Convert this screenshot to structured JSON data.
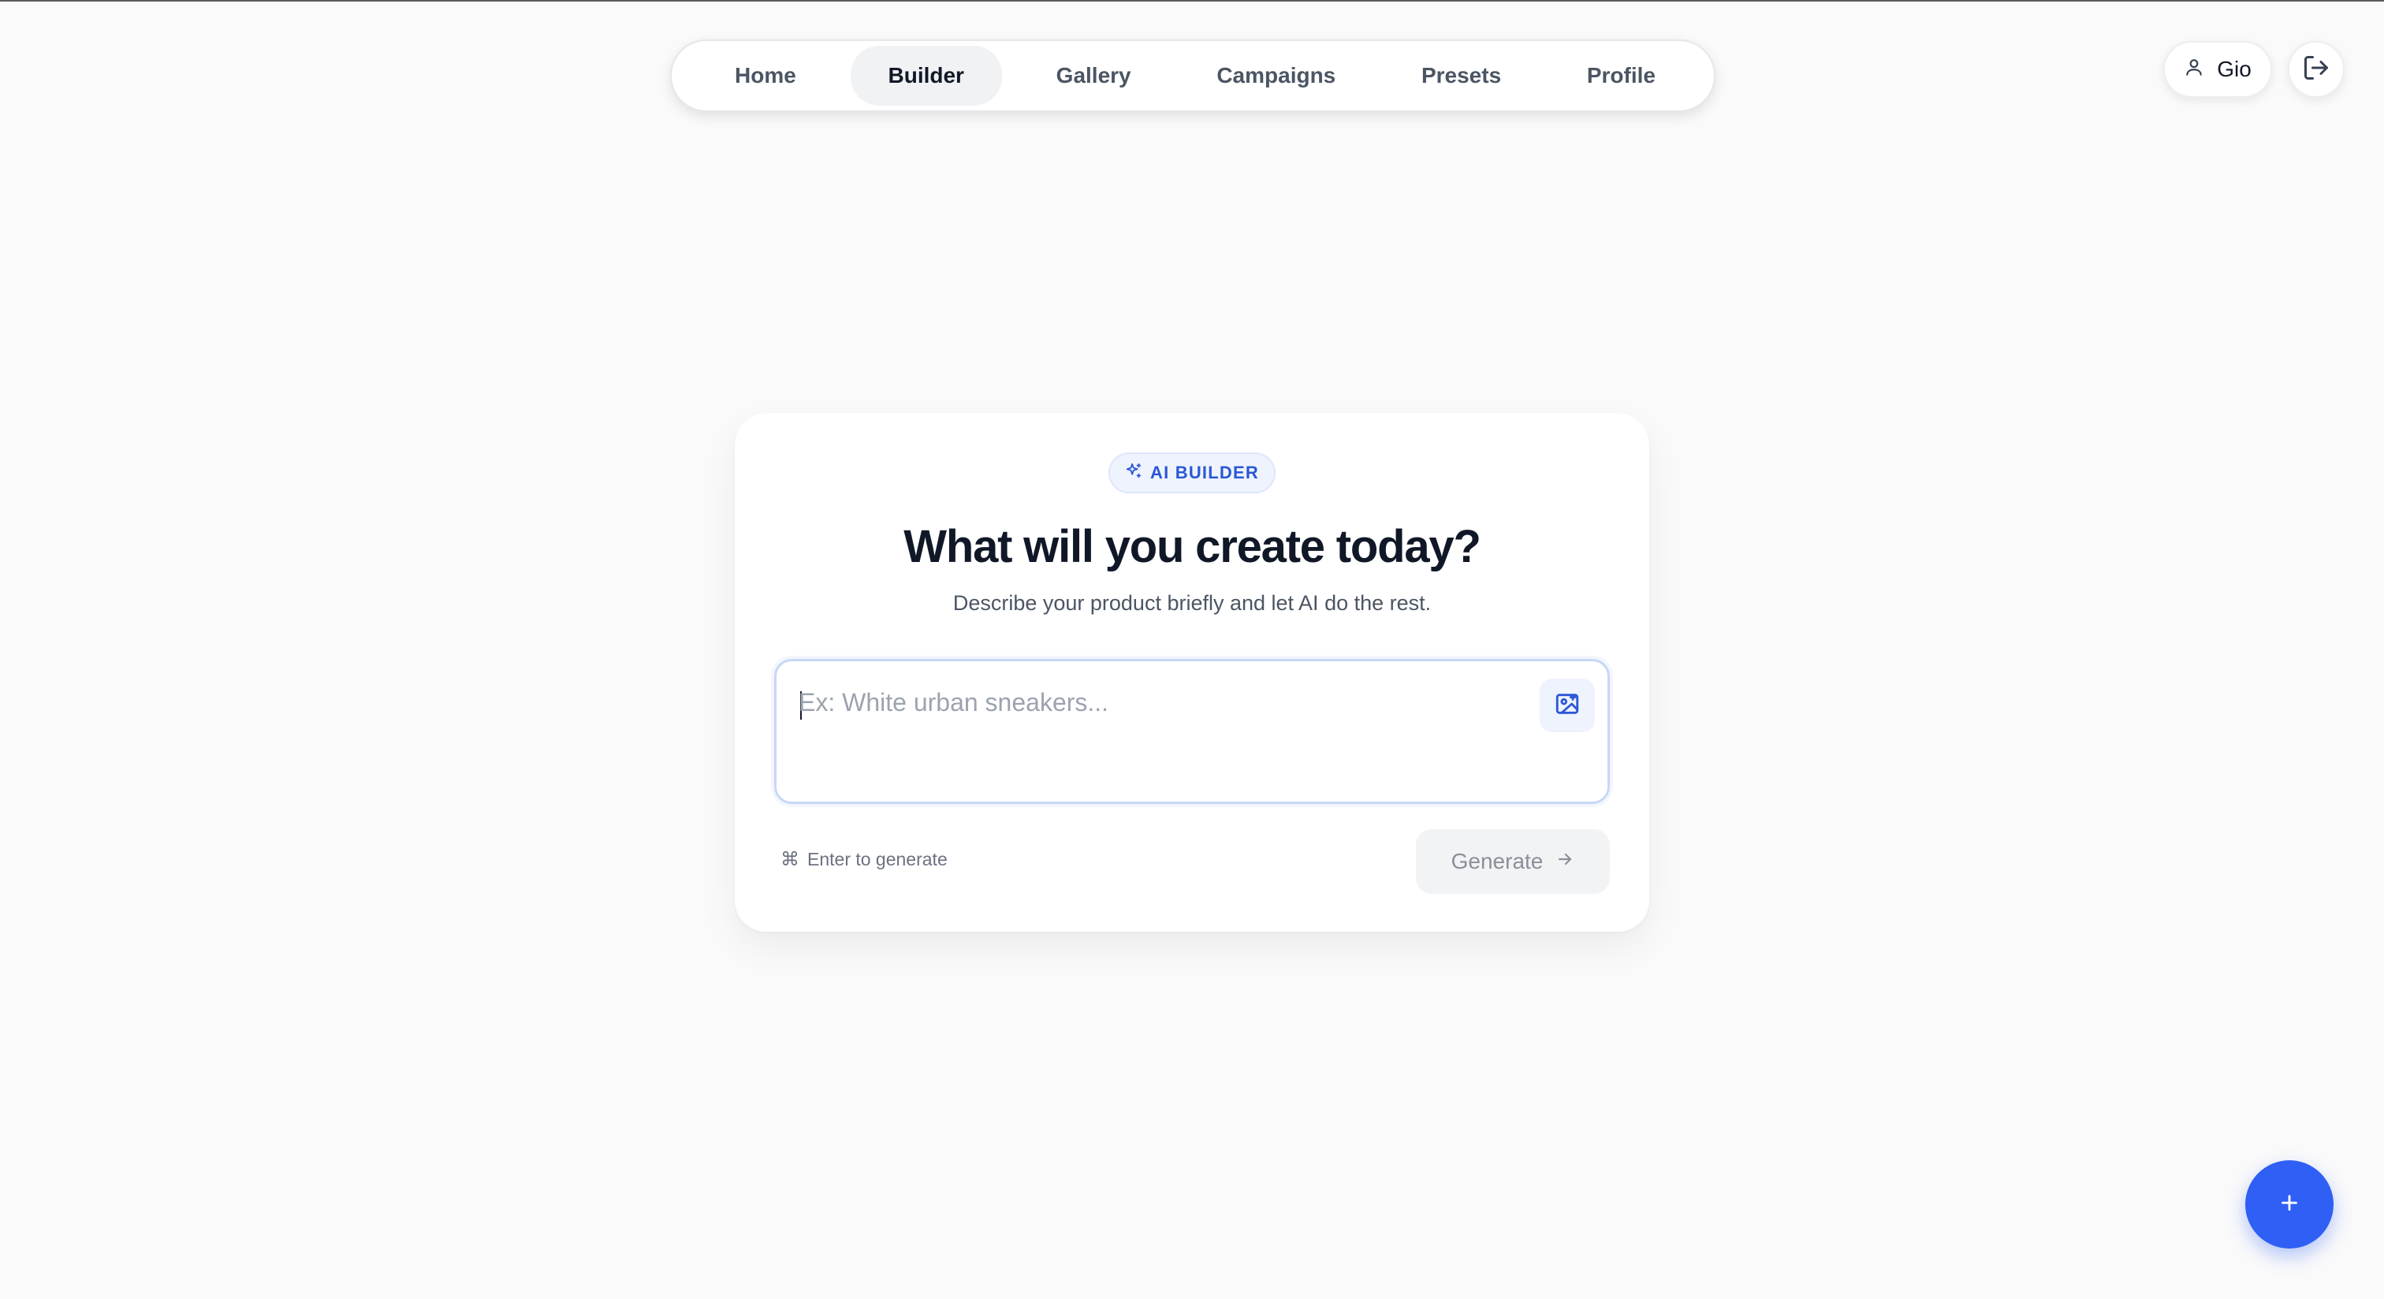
{
  "nav": {
    "items": [
      {
        "label": "Home",
        "active": false
      },
      {
        "label": "Builder",
        "active": true
      },
      {
        "label": "Gallery",
        "active": false
      },
      {
        "label": "Campaigns",
        "active": false
      },
      {
        "label": "Presets",
        "active": false
      },
      {
        "label": "Profile",
        "active": false
      }
    ]
  },
  "user": {
    "name": "Gio",
    "icon": "user-icon",
    "logout_icon": "logout-icon"
  },
  "builder": {
    "badge": "AI BUILDER",
    "badge_icon": "sparkles-icon",
    "title": "What will you create today?",
    "subtitle": "Describe your product briefly and let AI do the rest.",
    "prompt": {
      "value": "",
      "placeholder": "Ex: White urban sneakers...",
      "upload_icon": "image-upload-icon"
    },
    "hint": {
      "symbol": "⌘",
      "text": "Enter to generate"
    },
    "generate_label": "Generate",
    "generate_icon": "arrow-right-icon"
  },
  "fab": {
    "symbol": "+",
    "icon": "plus-icon"
  },
  "colors": {
    "accent": "#2f5ff5",
    "badge_text": "#2b57d6",
    "background": "#fafafa"
  }
}
